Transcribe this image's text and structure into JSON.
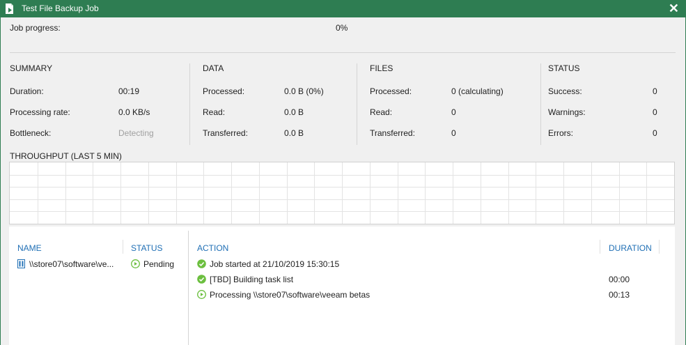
{
  "window": {
    "title": "Test File Backup Job",
    "close_symbol": "✕"
  },
  "progress": {
    "label": "Job progress:",
    "value": "0%"
  },
  "summary": {
    "heading": "SUMMARY",
    "rows": [
      {
        "label": "Duration:",
        "value": "00:19"
      },
      {
        "label": "Processing rate:",
        "value": "0.0 KB/s"
      },
      {
        "label": "Bottleneck:",
        "value": "Detecting"
      }
    ]
  },
  "data": {
    "heading": "DATA",
    "rows": [
      {
        "label": "Processed:",
        "value": "0.0 B (0%)"
      },
      {
        "label": "Read:",
        "value": "0.0 B"
      },
      {
        "label": "Transferred:",
        "value": "0.0 B"
      }
    ]
  },
  "files": {
    "heading": "FILES",
    "rows": [
      {
        "label": "Processed:",
        "value": "0 (calculating)"
      },
      {
        "label": "Read:",
        "value": "0"
      },
      {
        "label": "Transferred:",
        "value": "0"
      }
    ]
  },
  "status": {
    "heading": "STATUS",
    "rows": [
      {
        "label": "Success:",
        "value": "0"
      },
      {
        "label": "Warnings:",
        "value": "0"
      },
      {
        "label": "Errors:",
        "value": "0"
      }
    ]
  },
  "throughput": {
    "heading": "THROUGHPUT (LAST 5 MIN)"
  },
  "objects": {
    "headers": {
      "name": "NAME",
      "status": "STATUS"
    },
    "items": [
      {
        "name": "\\\\store07\\software\\ve...",
        "status": "Pending"
      }
    ]
  },
  "actions": {
    "headers": {
      "action": "ACTION",
      "duration": "DURATION"
    },
    "items": [
      {
        "text": "Job started at 21/10/2019 15:30:15",
        "duration": "",
        "icon": "success-icon"
      },
      {
        "text": "[TBD] Building task list",
        "duration": "00:00",
        "icon": "success-icon"
      },
      {
        "text": "Processing \\\\store07\\software\\veeam betas",
        "duration": "00:13",
        "icon": "running-icon"
      }
    ]
  },
  "colors": {
    "titlebar": "#2e7d52",
    "accent_blue": "#1f6fb5",
    "success_green": "#6cbf3f"
  }
}
